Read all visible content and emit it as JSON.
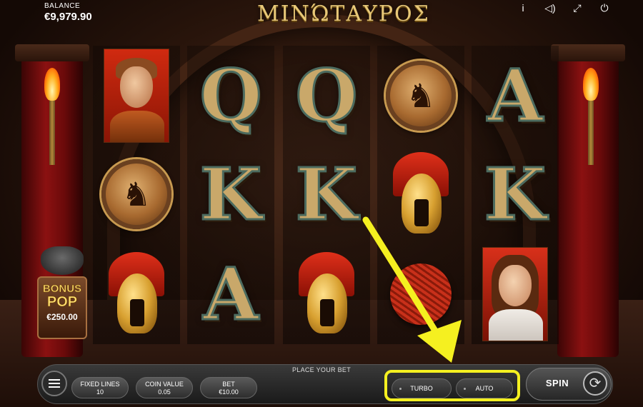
{
  "header": {
    "balance_label": "BALANCE",
    "balance_value": "€9,979.90",
    "logo_text": "ΜΙΝΏΤΑΥΡΟΣ",
    "icons": [
      "info-icon",
      "sound-icon",
      "fullscreen-icon",
      "power-icon"
    ]
  },
  "reels": [
    [
      "warrior-portrait",
      "pegasus-shield",
      "spartan-helmet"
    ],
    [
      "Q",
      "K",
      "A"
    ],
    [
      "Q",
      "K",
      "spartan-helmet"
    ],
    [
      "pegasus-shield",
      "spartan-helmet",
      "red-yarn-ball"
    ],
    [
      "A",
      "K",
      "woman-portrait"
    ]
  ],
  "bonus": {
    "line1": "BONUS",
    "line2": "POP",
    "amount": "€250.00"
  },
  "bottom": {
    "place_bet": "PLACE YOUR BET",
    "fixed_lines_label": "FIXED LINES",
    "fixed_lines_value": "10",
    "coin_value_label": "COIN VALUE",
    "coin_value_value": "0.05",
    "bet_label": "BET",
    "bet_value": "€10.00",
    "turbo_label": "TURBO",
    "auto_label": "AUTO",
    "spin_label": "SPIN"
  },
  "colors": {
    "highlight": "#f5f020",
    "pillar": "#8b1111",
    "letter": "#c9a86a"
  }
}
